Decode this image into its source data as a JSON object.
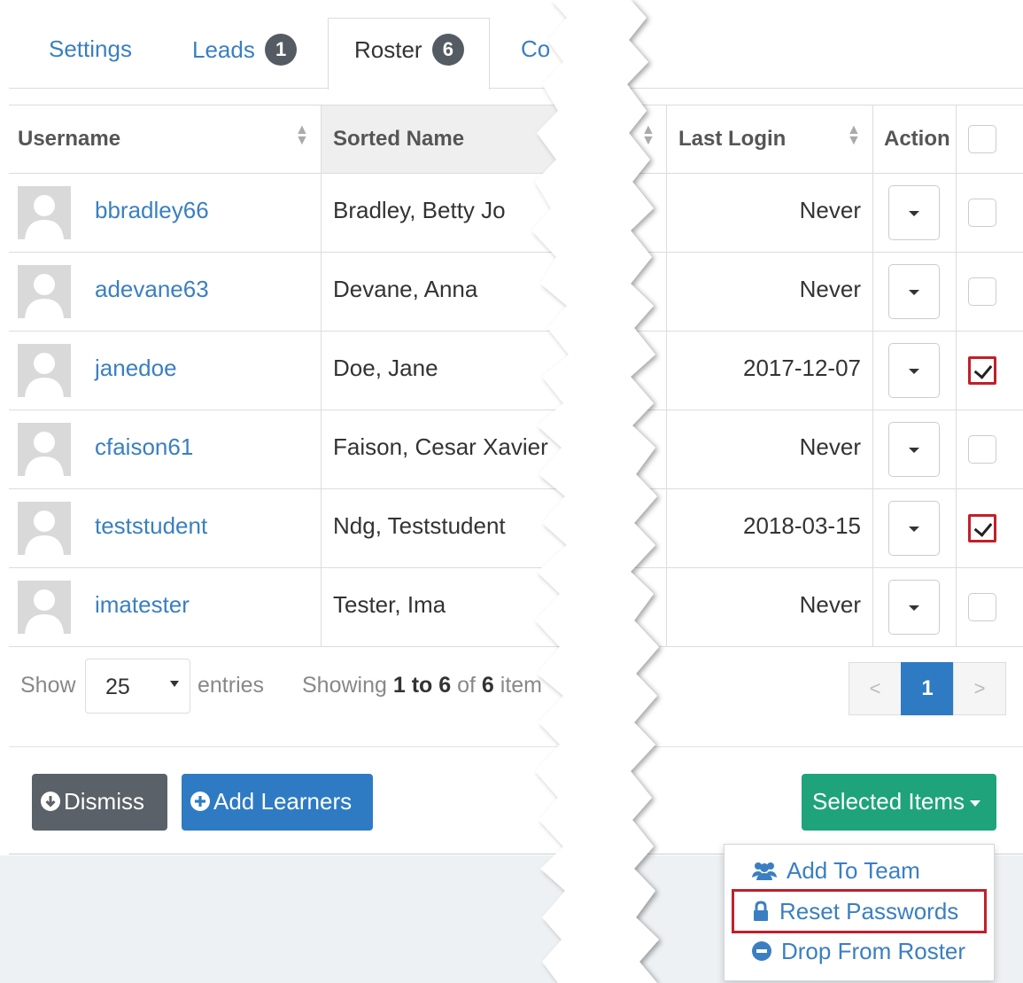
{
  "tabs": [
    {
      "label": "Settings",
      "badge": ""
    },
    {
      "label": "Leads",
      "badge": "1"
    },
    {
      "label": "Roster",
      "badge": "6",
      "active": true
    },
    {
      "label": "Co",
      "badge": ""
    }
  ],
  "table": {
    "headers": {
      "username": "Username",
      "sorted_name": "Sorted Name",
      "last_login": "Last Login",
      "action": "Action"
    },
    "rows": [
      {
        "username": "bbradley66",
        "sorted_name": "Bradley, Betty Jo",
        "last_login": "Never",
        "checked": false
      },
      {
        "username": "adevane63",
        "sorted_name": "Devane, Anna",
        "last_login": "Never",
        "checked": false
      },
      {
        "username": "janedoe",
        "sorted_name": "Doe, Jane",
        "last_login": "2017-12-07",
        "checked": true
      },
      {
        "username": "cfaison61",
        "sorted_name": "Faison, Cesar Xavier",
        "last_login": "Never",
        "checked": false
      },
      {
        "username": "teststudent",
        "sorted_name": "Ndg, Teststudent",
        "last_login": "2018-03-15",
        "checked": true
      },
      {
        "username": "imatester",
        "sorted_name": "Tester, Ima",
        "last_login": "Never",
        "checked": false
      }
    ]
  },
  "footer": {
    "show_label": "Show",
    "entries_value": "25",
    "entries_label": "entries",
    "showing_label": "Showing",
    "range": "1 to 6",
    "of_label": "of",
    "total": "6",
    "items_label": "item",
    "pager": {
      "prev": "<",
      "page": "1",
      "next": ">"
    }
  },
  "buttons": {
    "dismiss": "Dismiss",
    "add_learners": "Add Learners",
    "selected_items": "Selected Items"
  },
  "menu": {
    "add_to_team": "Add To Team",
    "reset_passwords": "Reset Passwords",
    "drop_from_roster": "Drop From Roster"
  },
  "colors": {
    "link": "#3a7fc1",
    "primary": "#2e7bc4",
    "success": "#1fa37a",
    "dark": "#5b6168",
    "highlight": "#c0202a"
  },
  "icons": {
    "sort": "sort-icon",
    "dismiss": "arrow-down-circle-icon",
    "add": "plus-circle-icon",
    "team": "users-icon",
    "reset": "lock-icon",
    "drop": "minus-circle-icon"
  }
}
